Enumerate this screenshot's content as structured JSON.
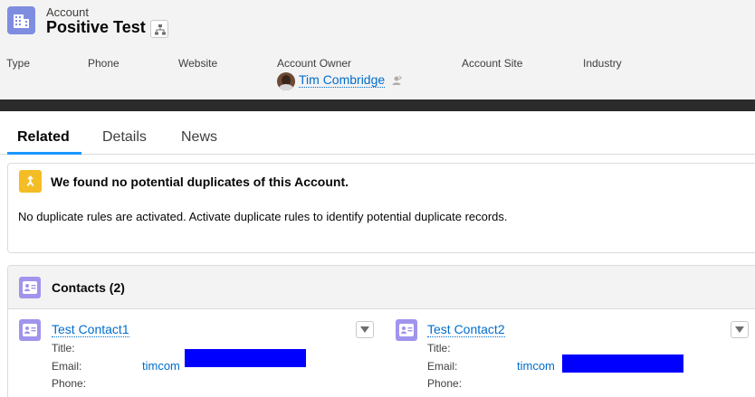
{
  "header": {
    "object_label": "Account",
    "record_title": "Positive Test",
    "icons": {
      "object": "account-building-icon",
      "hierarchy": "hierarchy-icon",
      "change_owner": "change-owner-icon"
    },
    "fields": {
      "type_label": "Type",
      "phone_label": "Phone",
      "website_label": "Website",
      "owner_label": "Account Owner",
      "owner_name": "Tim Combridge",
      "site_label": "Account Site",
      "industry_label": "Industry"
    }
  },
  "tabs": [
    {
      "label": "Related",
      "active": true
    },
    {
      "label": "Details",
      "active": false
    },
    {
      "label": "News",
      "active": false
    }
  ],
  "duplicates": {
    "icon": "duplicate-merge-icon",
    "title": "We found no potential duplicates of this Account.",
    "message": "No duplicate rules are activated. Activate duplicate rules to identify potential duplicate records."
  },
  "contacts": {
    "icon": "contact-card-icon",
    "title": "Contacts (2)",
    "labels": {
      "title": "Title:",
      "email": "Email:",
      "phone": "Phone:"
    },
    "items": [
      {
        "name": "Test Contact1",
        "title": "",
        "email": "timcom",
        "phone": ""
      },
      {
        "name": "Test Contact2",
        "title": "",
        "email": "timcom",
        "phone": ""
      }
    ]
  },
  "colors": {
    "account_icon": "#7f8de1",
    "contact_icon": "#a094ed",
    "duplicate_icon": "#f4bc25",
    "link": "#006dcc",
    "tab_active": "#1b96ff",
    "redaction": "#0000ff"
  }
}
